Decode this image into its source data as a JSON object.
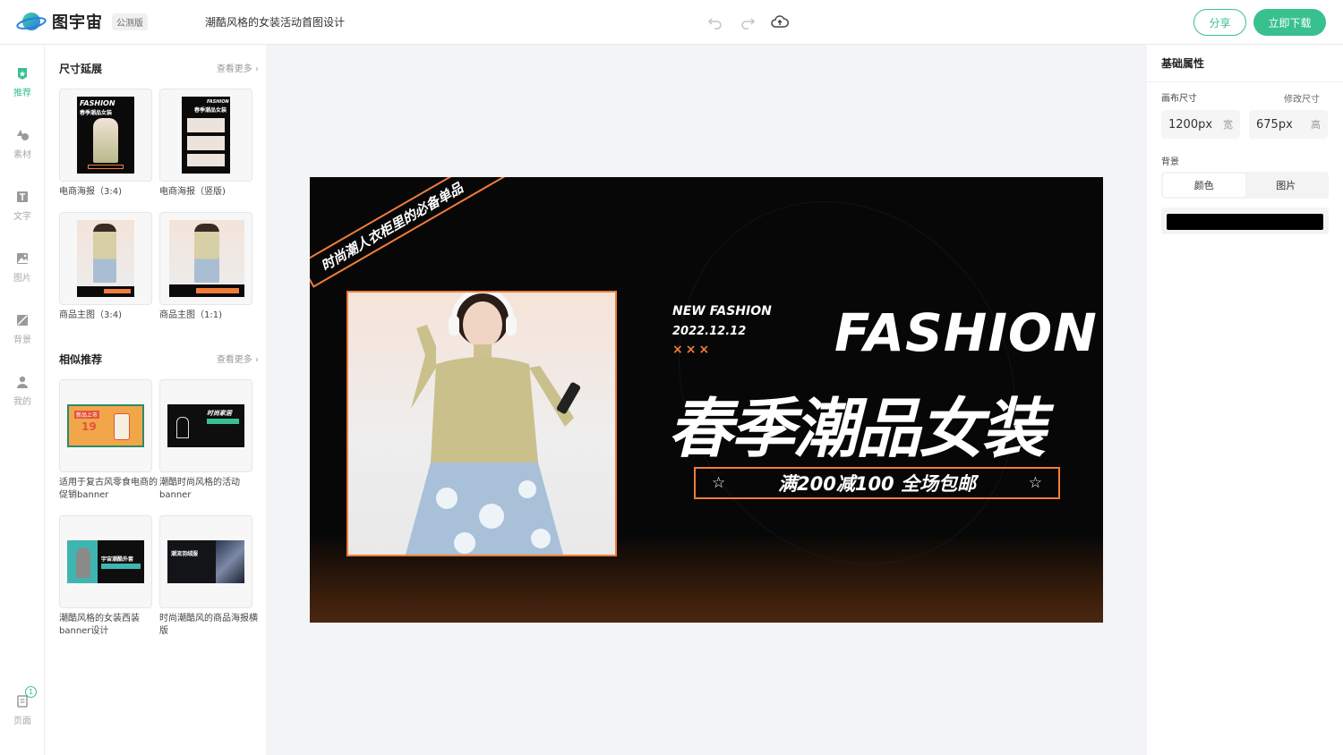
{
  "app": {
    "name": "图宇宙",
    "beta_label": "公测版",
    "doc_title": "潮酷风格的女装活动首图设计"
  },
  "toolbar": {
    "share_label": "分享",
    "download_label": "立即下载",
    "icons": [
      "undo-icon",
      "redo-icon",
      "cloud-upload-icon"
    ]
  },
  "rail": {
    "items": [
      {
        "label": "推荐",
        "icon": "star-badge-icon",
        "active": true
      },
      {
        "label": "素材",
        "icon": "shapes-icon",
        "active": false
      },
      {
        "label": "文字",
        "icon": "text-icon",
        "active": false
      },
      {
        "label": "图片",
        "icon": "image-icon",
        "active": false
      },
      {
        "label": "背景",
        "icon": "background-icon",
        "active": false
      },
      {
        "label": "我的",
        "icon": "user-icon",
        "active": false
      }
    ],
    "pages_label": "页面",
    "pages_count": "1"
  },
  "panel": {
    "size_section": {
      "title": "尺寸延展",
      "more": "查看更多",
      "cards": [
        {
          "label": "电商海报（3:4)",
          "thumb_title": "FASHION",
          "thumb_sub": "春季潮品女装"
        },
        {
          "label": "电商海报（竖版)",
          "thumb_title": "FASHION",
          "thumb_sub": "春季潮品女装"
        },
        {
          "label": "商品主图（3:4)"
        },
        {
          "label": "商品主图（1:1)"
        }
      ]
    },
    "similar_section": {
      "title": "相似推荐",
      "more": "查看更多",
      "cards": [
        {
          "label": "适用于复古风零食电商的促销banner",
          "thumb_text": "新品上市",
          "thumb_num": "19"
        },
        {
          "label": "潮酷时尚风格的活动banner",
          "thumb_text": "时尚家居"
        },
        {
          "label": "潮酷风格的女装西装banner设计",
          "thumb_text": "宇宙潮酷外套"
        },
        {
          "label": "时尚潮酷风的商品海报横版",
          "thumb_text": "潮流羽绒服"
        }
      ]
    }
  },
  "design": {
    "ribbon_text": "时尚潮人衣柜里的必备单品",
    "ribbon_star": "☆",
    "new_fashion": "NEW FASHION",
    "date": "2022.12.12",
    "marks": "×××",
    "fashion": "FASHION",
    "headline": "春季潮品女装",
    "promo": "满200减100 全场包邮",
    "promo_star": "☆"
  },
  "props": {
    "title": "基础属性",
    "canvas_size_label": "画布尺寸",
    "resize_label": "修改尺寸",
    "width_value": "1200px",
    "width_unit": "宽",
    "height_value": "675px",
    "height_unit": "高",
    "background_label": "背景",
    "bg_tabs": [
      "颜色",
      "图片"
    ],
    "bg_color": "#000000"
  },
  "colors": {
    "accent": "#39c08f",
    "design_orange": "#f07c3a"
  }
}
